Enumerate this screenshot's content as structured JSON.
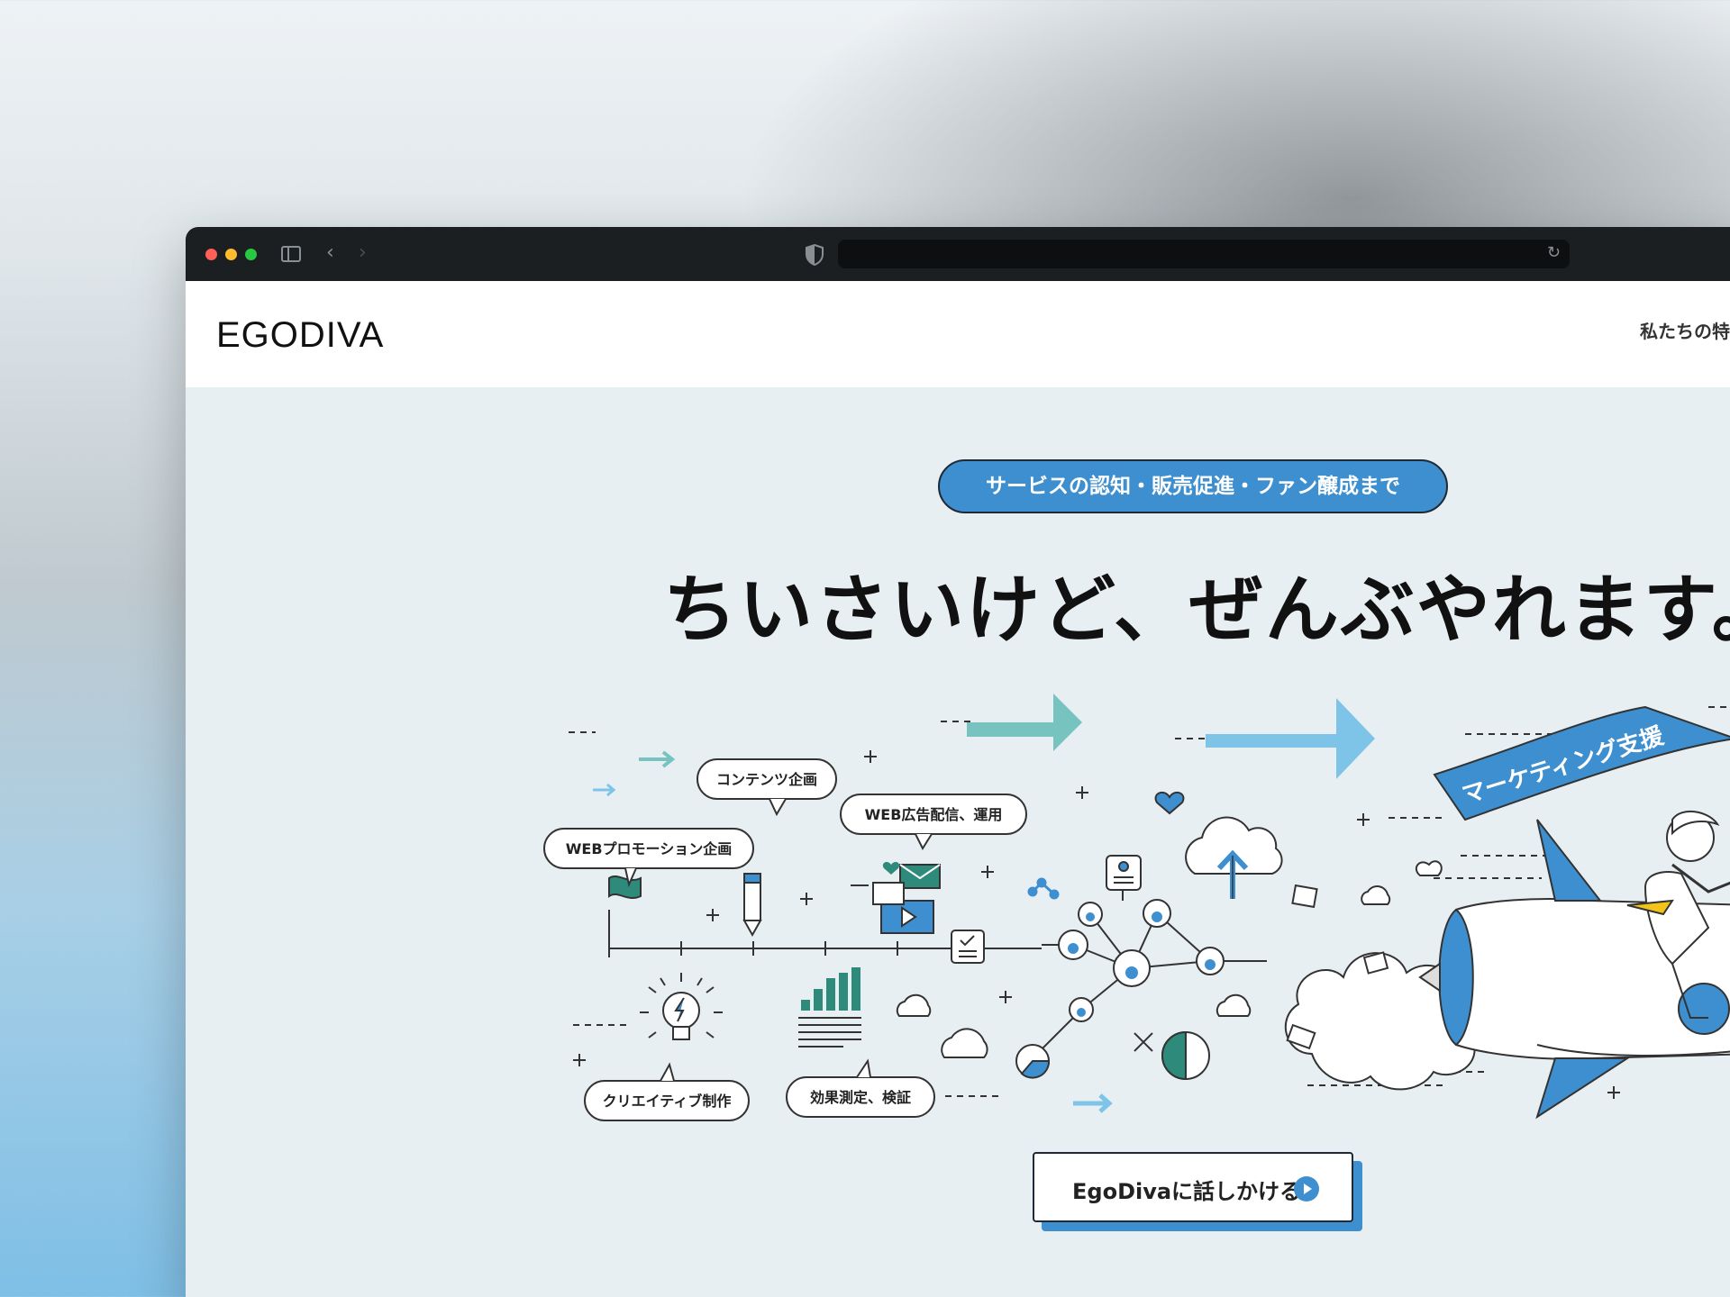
{
  "browser": {
    "address": "",
    "icons": [
      "sidebar-toggle-icon",
      "back-icon",
      "forward-icon",
      "shield-icon",
      "reload-icon"
    ]
  },
  "site": {
    "logo": "EGODIVA",
    "nav": {
      "features_label": "私たちの特"
    }
  },
  "hero": {
    "pill": "サービスの認知・販売促進・ファン醸成まで",
    "headline": "ちいさいけど、ぜんぶやれます。",
    "bubbles": {
      "content_planning": "コンテンツ企画",
      "web_promotion": "WEBプロモーション企画",
      "web_ads": "WEB広告配信、運用",
      "creative": "クリエイティブ制作",
      "measurement": "効果測定、検証"
    },
    "banner": "マーケティング支援",
    "cta_label": "EgoDivaに話しかける"
  },
  "colors": {
    "accent_blue": "#3e8fcf",
    "light_blue": "#7ec3e8",
    "teal": "#76c3c0",
    "dark_green": "#2e8a7a",
    "hero_bg": "#e8eff3"
  }
}
